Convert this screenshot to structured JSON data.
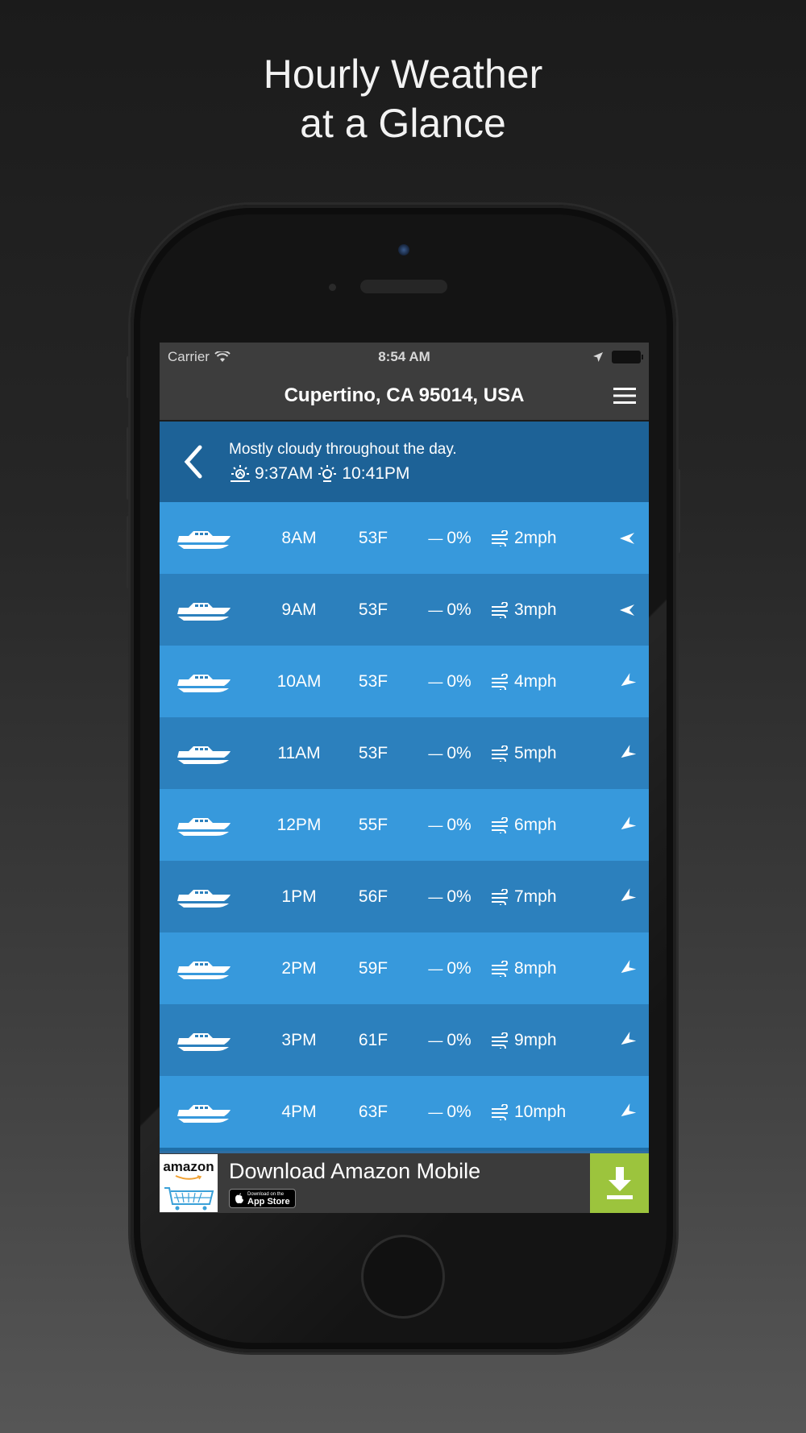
{
  "headline": {
    "line1": "Hourly Weather",
    "line2": "at a Glance"
  },
  "status_bar": {
    "carrier": "Carrier",
    "time": "8:54 AM"
  },
  "nav": {
    "title": "Cupertino, CA 95014, USA"
  },
  "summary": {
    "description": "Mostly cloudy throughout the day.",
    "sunrise": "9:37AM",
    "sunset": "10:41PM"
  },
  "hourly": [
    {
      "hour": "8AM",
      "temp": "53F",
      "precip": "0%",
      "wind": "2mph"
    },
    {
      "hour": "9AM",
      "temp": "53F",
      "precip": "0%",
      "wind": "3mph"
    },
    {
      "hour": "10AM",
      "temp": "53F",
      "precip": "0%",
      "wind": "4mph"
    },
    {
      "hour": "11AM",
      "temp": "53F",
      "precip": "0%",
      "wind": "5mph"
    },
    {
      "hour": "12PM",
      "temp": "55F",
      "precip": "0%",
      "wind": "6mph"
    },
    {
      "hour": "1PM",
      "temp": "56F",
      "precip": "0%",
      "wind": "7mph"
    },
    {
      "hour": "2PM",
      "temp": "59F",
      "precip": "0%",
      "wind": "8mph"
    },
    {
      "hour": "3PM",
      "temp": "61F",
      "precip": "0%",
      "wind": "9mph"
    },
    {
      "hour": "4PM",
      "temp": "63F",
      "precip": "0%",
      "wind": "10mph"
    }
  ],
  "ad": {
    "logo_text": "amazon",
    "title": "Download Amazon Mobile",
    "badge_small": "Download on the",
    "badge_big": "App Store"
  },
  "colors": {
    "row_light": "#3799dc",
    "row_dark": "#2c80bd",
    "summary_bg": "#1d6297",
    "navbar_bg": "#3d3d3d",
    "ad_download_bg": "#9cc43d"
  },
  "icons": [
    "wifi-icon",
    "location-arrow-icon",
    "battery-icon",
    "menu-icon",
    "back-chevron-icon",
    "sunrise-icon",
    "sunset-icon",
    "boat-icon",
    "wind-icon",
    "wind-direction-icon",
    "download-icon",
    "apple-icon"
  ]
}
